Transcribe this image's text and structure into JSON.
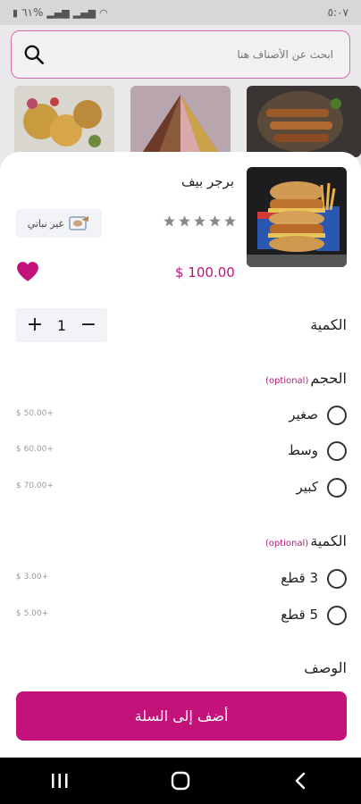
{
  "status_bar": {
    "battery": "٦١%",
    "time": "٥:٠٧"
  },
  "search": {
    "placeholder": "ابحث عن الأصناف هنا"
  },
  "product": {
    "name": "برجر بيف",
    "rating": 0,
    "rating_max": 5,
    "veg_label": "غير نباتي",
    "price": "$ 100.00",
    "favorite": true
  },
  "quantity": {
    "label": "الكمية",
    "value": "1",
    "plus": "+",
    "minus": "−"
  },
  "size_group": {
    "title": "الحجم",
    "optional": "(optional)",
    "options": [
      {
        "name": "صغير",
        "price": "$ 50.00+"
      },
      {
        "name": "وسط",
        "price": "$ 60.00+"
      },
      {
        "name": "كبير",
        "price": "$ 70.00+"
      }
    ]
  },
  "pieces_group": {
    "title": "الكمية",
    "optional": "(optional)",
    "options": [
      {
        "name": "3 قطع",
        "price": "$ 3.00+"
      },
      {
        "name": "5 قطع",
        "price": "$ 5.00+"
      }
    ]
  },
  "description": {
    "title": "الوصف"
  },
  "add_to_cart": {
    "label": "أضف إلى السلة"
  },
  "colors": {
    "accent": "#c3127a",
    "search_border": "#d76aa4"
  }
}
